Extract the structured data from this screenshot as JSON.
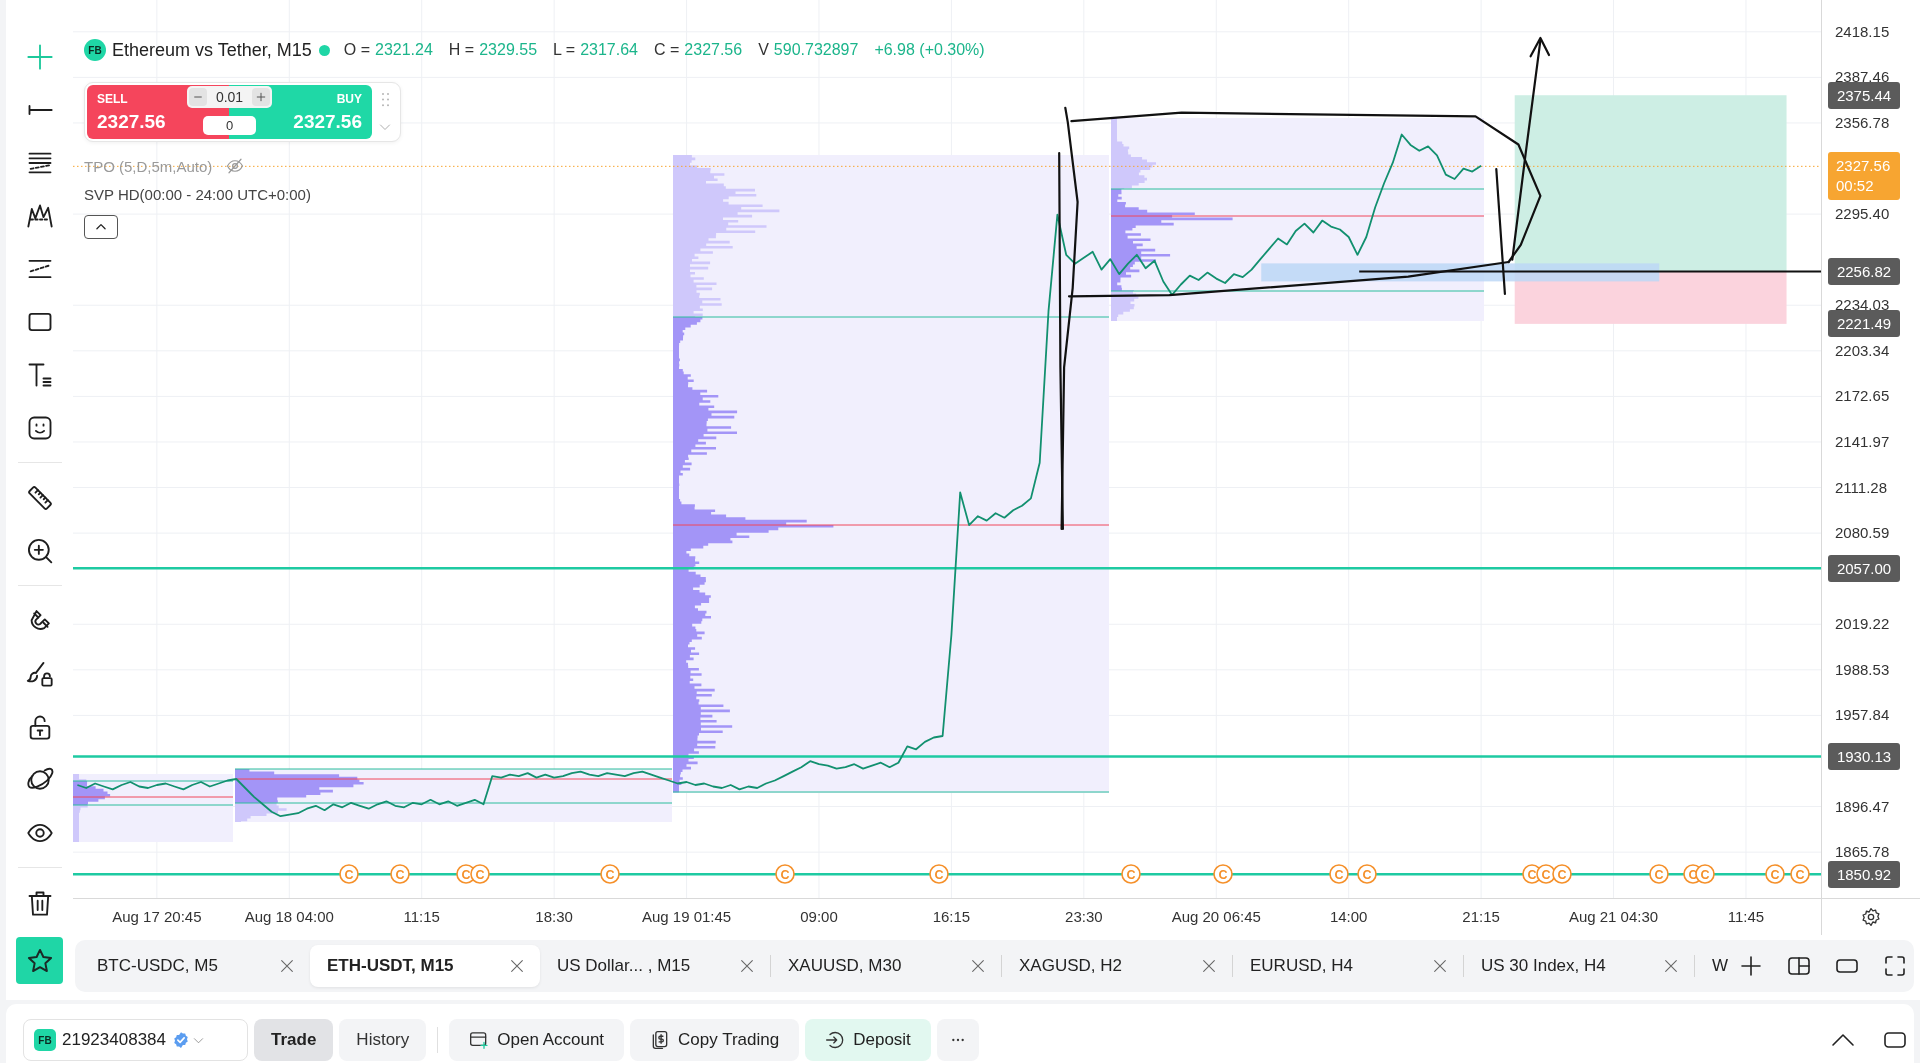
{
  "toolbar": {
    "groups": [
      [
        {
          "kind": "cross",
          "selected": true
        },
        {
          "kind": "line",
          "selected": false
        },
        {
          "kind": "fib",
          "selected": false
        },
        {
          "kind": "pattern",
          "selected": false
        },
        {
          "kind": "channel",
          "selected": false
        },
        {
          "kind": "rectangle",
          "selected": false
        },
        {
          "kind": "text",
          "selected": false
        },
        {
          "kind": "emoji",
          "selected": false
        }
      ],
      [
        {
          "kind": "ruler",
          "selected": false
        },
        {
          "kind": "zoom",
          "selected": false
        }
      ],
      [
        {
          "kind": "magnet",
          "selected": false
        },
        {
          "kind": "drawlock",
          "selected": false
        },
        {
          "kind": "lock",
          "selected": false
        },
        {
          "kind": "planet",
          "selected": false
        },
        {
          "kind": "eye",
          "selected": false
        }
      ],
      [
        {
          "kind": "trash",
          "selected": false
        }
      ]
    ]
  },
  "chart": {
    "legend": {
      "logo": "FB",
      "title": "Ethereum vs Tether, M15",
      "ohlc": [
        {
          "label": "O =",
          "value": "2321.24"
        },
        {
          "label": "H =",
          "value": "2329.55"
        },
        {
          "label": "L =",
          "value": "2317.64"
        },
        {
          "label": "C =",
          "value": "2327.56"
        },
        {
          "label": "V",
          "value": "590.732897"
        }
      ],
      "change": "+6.98 (+0.30%)"
    },
    "trade_panel": {
      "sell_label": "SELL",
      "sell_price": "2327.56",
      "quantity": "0.01",
      "spread": "0",
      "buy_label": "BUY",
      "buy_price": "2327.56"
    },
    "indicators": [
      {
        "label": "TPO (5,D,5m,Auto)",
        "hidden": true
      },
      {
        "label": "SVP HD(00:00 - 24:00 UTC+0:00)",
        "hidden": false
      }
    ],
    "price_markers": [
      {
        "kind": "target",
        "label": "2375.44"
      },
      {
        "kind": "entry",
        "label": "2256.82"
      },
      {
        "kind": "stop",
        "label": "2221.49"
      }
    ],
    "countdown": "00:52",
    "events": [
      {
        "text": "C"
      },
      {
        "text": "C"
      },
      {
        "text": "C"
      },
      {
        "text": "C"
      },
      {
        "text": "C"
      },
      {
        "text": "C"
      },
      {
        "text": "C"
      },
      {
        "text": "C"
      },
      {
        "text": "C"
      },
      {
        "text": "C"
      },
      {
        "text": "C"
      },
      {
        "text": "C"
      },
      {
        "text": "C"
      },
      {
        "text": "C"
      },
      {
        "text": "C"
      },
      {
        "text": "C"
      },
      {
        "text": "C"
      },
      {
        "text": "C"
      },
      {
        "text": "C"
      }
    ],
    "chart_data": {
      "type": "line",
      "grid": true,
      "categories": [
        null,
        null,
        null,
        null,
        null,
        null,
        null,
        null,
        null,
        "Aug 17 20:45",
        null,
        null,
        null,
        null,
        null,
        null,
        null,
        null,
        null,
        null,
        null,
        null,
        null,
        null,
        "Aug 18 04:00",
        null,
        null,
        null,
        null,
        null,
        null,
        null,
        null,
        null,
        null,
        null,
        null,
        null,
        null,
        "11:15",
        null,
        null,
        null,
        null,
        null,
        null,
        null,
        null,
        null,
        null,
        null,
        null,
        null,
        null,
        "18:30",
        null,
        null,
        null,
        null,
        null,
        null,
        null,
        null,
        null,
        null,
        null,
        null,
        null,
        null,
        "Aug 19 01:45",
        null,
        null,
        null,
        null,
        null,
        null,
        null,
        null,
        null,
        null,
        null,
        null,
        null,
        null,
        "09:00",
        null,
        null,
        null,
        null,
        null,
        null,
        null,
        null,
        null,
        null,
        null,
        null,
        null,
        null,
        "16:15",
        null,
        null,
        null,
        null,
        null,
        null,
        null,
        null,
        null,
        null,
        null,
        null,
        null,
        null,
        "23:30",
        null,
        null,
        null,
        null,
        null,
        null,
        null,
        null,
        null,
        null,
        null,
        null,
        null,
        null,
        "Aug 20 06:45",
        null,
        null,
        null,
        null,
        null,
        null,
        null,
        null,
        null,
        null,
        null,
        null,
        null,
        null,
        "14:00",
        null,
        null,
        null,
        null,
        null,
        null,
        null,
        null,
        null,
        null,
        null,
        null,
        null,
        null,
        "21:15",
        null,
        null,
        null,
        null,
        null,
        null,
        null,
        null,
        null,
        null,
        null,
        null,
        null,
        null,
        "Aug 21 04:30",
        null,
        null,
        null,
        null,
        null,
        null,
        null,
        null,
        null,
        null,
        null,
        null,
        null,
        null,
        "11:45",
        null,
        null,
        null,
        null,
        null,
        null,
        null,
        null
      ],
      "series": [
        {
          "values": [
            1911,
            1909,
            1912,
            1910,
            1908,
            1911,
            1913,
            1910,
            1909,
            1911,
            1912,
            1910,
            1908,
            1911,
            1913,
            1910,
            1912,
            1914,
            1915,
            1909,
            1903,
            1898,
            1893,
            1890,
            1891,
            1892,
            1895,
            1897,
            1894,
            1898,
            1896,
            1899,
            1897,
            1895,
            1898,
            1900,
            1897,
            1896,
            1899,
            1898,
            1901,
            1898,
            1900,
            1897,
            1899,
            1901,
            1898,
            1917,
            1916,
            1918,
            1917,
            1919,
            1916,
            1918,
            1916,
            1917,
            1919,
            1920,
            1918,
            1917,
            1919,
            1918,
            1917,
            1919,
            1920,
            1918,
            1916,
            1914,
            1912,
            1913,
            1911,
            1912,
            1910,
            1909,
            1911,
            1908,
            1910,
            1909,
            1912,
            1914,
            1917,
            1920,
            1923,
            1927,
            1925,
            1924,
            1922,
            1923,
            1925,
            1922,
            1924,
            1926,
            1923,
            1926,
            1937,
            1935,
            1940,
            1943,
            1944,
            2012,
            2108,
            2086,
            2092,
            2089,
            2094,
            2091,
            2096,
            2099,
            2104,
            2128,
            2230,
            2295,
            2268,
            2262,
            2266,
            2270,
            2258,
            2265,
            2255,
            2262,
            2268,
            2259,
            2264,
            2250,
            2241,
            2248,
            2254,
            2251,
            2256,
            2252,
            2249,
            2255,
            2253,
            2258,
            2265,
            2272,
            2279,
            2275,
            2284,
            2289,
            2283,
            2291,
            2287,
            2285,
            2280,
            2268,
            2280,
            2300,
            2316,
            2330,
            2349,
            2342,
            2338,
            2341,
            2335,
            2322,
            2319,
            2326,
            2324,
            2328,
            null,
            null,
            null,
            null,
            null,
            null,
            null,
            null,
            null,
            null,
            null,
            null,
            null,
            null,
            null,
            null,
            null,
            null,
            null,
            null,
            null,
            null,
            null,
            null,
            null,
            null,
            null,
            null,
            null,
            null,
            null,
            null,
            null,
            null,
            null,
            null,
            null,
            null
          ]
        }
      ],
      "ylim": [
        1834.9,
        2439.56
      ],
      "yticks": [
        2418.15,
        2387.46,
        2356.78,
        {
          "value": 2295.4,
          "label": "2295.40"
        },
        2234.03,
        2203.34,
        2172.65,
        2141.97,
        2111.28,
        2080.59,
        2019.22,
        1988.53,
        1957.84,
        1896.47,
        1865.78
      ],
      "ref_lines": [
        {
          "axis": "y",
          "value": 2327.56,
          "label": "2327.56",
          "color": "#f7a531"
        },
        {
          "axis": "y",
          "value": 2057.0,
          "label": "2057.00",
          "color": "#1ecaa2"
        },
        {
          "axis": "y",
          "value": 1930.13,
          "label": "1930.13",
          "color": "#1ecaa2"
        },
        {
          "axis": "y",
          "value": 1850.92,
          "label": "1850.92",
          "color": "#1ecaa2"
        }
      ]
    }
  },
  "tabs": [
    {
      "label": "BTC-USDC, M5",
      "selected": false,
      "truncated": false
    },
    {
      "label": "ETH-USDT, M15",
      "selected": true,
      "truncated": false
    },
    {
      "label": "US Dollar... , M15",
      "selected": false,
      "truncated": false
    },
    {
      "label": "XAUUSD, M30",
      "selected": false,
      "truncated": false
    },
    {
      "label": "XAGUSD, H2",
      "selected": false,
      "truncated": false
    },
    {
      "label": "EURUSD, H4",
      "selected": false,
      "truncated": false
    },
    {
      "label": "US 30 Index, H4",
      "selected": false,
      "truncated": false
    },
    {
      "label": "W",
      "selected": false,
      "truncated": true
    }
  ],
  "account": {
    "logo": "FB",
    "number": "21923408384",
    "verified": true
  },
  "view_tabs": [
    {
      "label": "Trade",
      "selected": true
    },
    {
      "label": "History",
      "selected": false
    }
  ],
  "actions": [
    {
      "kind": "account",
      "label": "Open Account"
    },
    {
      "kind": "copy",
      "label": "Copy Trading"
    },
    {
      "kind": "deposit",
      "label": "Deposit"
    },
    {
      "kind": "more"
    }
  ]
}
